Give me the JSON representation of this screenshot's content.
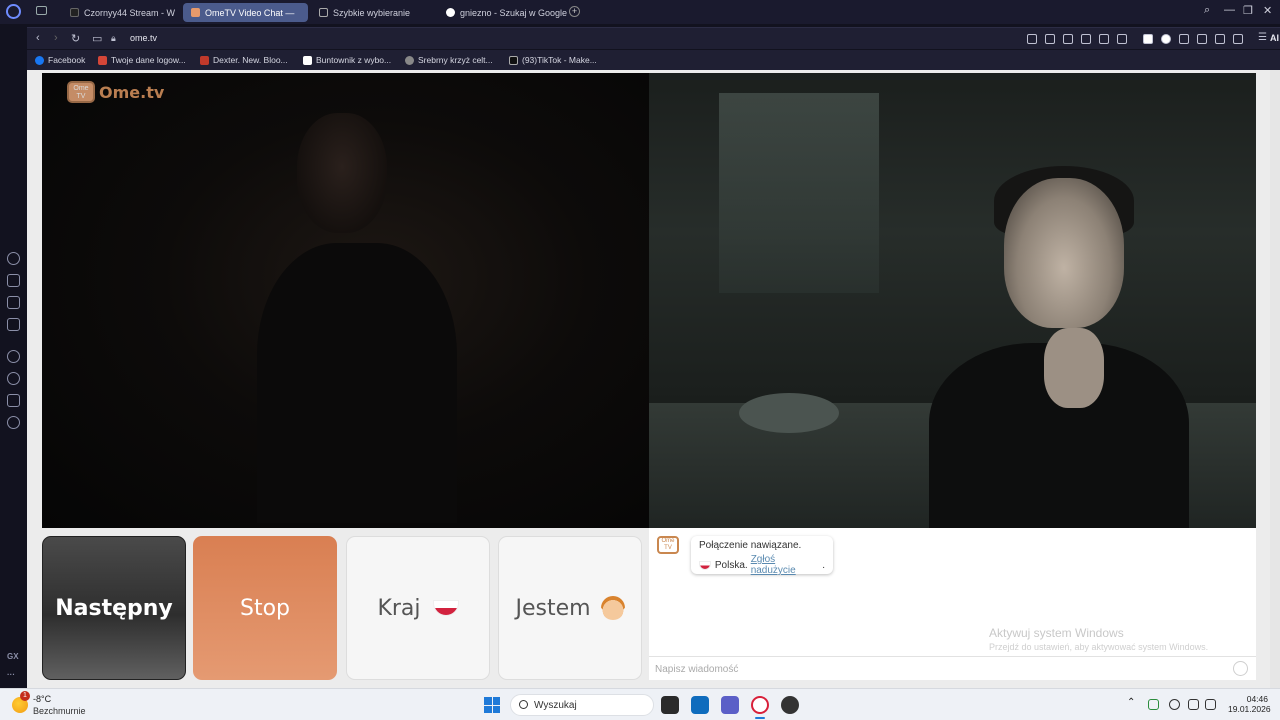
{
  "browser": {
    "tabs": [
      {
        "label": "Czornyy44 Stream - W",
        "active": false
      },
      {
        "label": "OmeTV Video Chat —",
        "active": true
      },
      {
        "label": "Szybkie wybieranie",
        "active": false
      },
      {
        "label": "gniezno - Szukaj w Google",
        "active": false
      }
    ],
    "url": "ome.tv",
    "ai_label": "AI",
    "sidebar_gx": "GX",
    "sidebar_more": "···"
  },
  "bookmarks": [
    {
      "label": "Facebook",
      "color": "#1877f2"
    },
    {
      "label": "Twoje dane logow...",
      "color": "#d44638"
    },
    {
      "label": "Dexter. New. Bloo...",
      "color": "#c0392b"
    },
    {
      "label": "Buntownik z wybo...",
      "color": "#ffffff"
    },
    {
      "label": "Srebrny krzyż celt...",
      "color": "#888888"
    },
    {
      "label": "(93)TikTok - Make...",
      "color": "#111111"
    }
  ],
  "site": {
    "logo_text": "Ome.tv",
    "logo_box_text": "Ome TV",
    "buttons": {
      "next": "Następny",
      "stop": "Stop",
      "country": "Kraj",
      "iam": "Jestem"
    },
    "chat": {
      "avatar_text": "Ome TV",
      "message_line1": "Połączenie nawiązane.",
      "message_country": "Polska.",
      "report_link": "Zgłoś nadużycie",
      "report_suffix": ".",
      "input_placeholder": "Napisz wiadomość"
    },
    "watermark": {
      "title": "Aktywuj system Windows",
      "subtitle": "Przejdź do ustawień, aby aktywować system Windows."
    }
  },
  "taskbar": {
    "weather_badge": "1",
    "temperature": "-8°C",
    "weather_desc": "Bezchmurnie",
    "search_label": "Wyszukaj",
    "time": "04:46",
    "date": "19.01.2026"
  },
  "colors": {
    "accent": "#d97f52",
    "tab_active": "#4b5b8c",
    "link": "#5a8ab0"
  }
}
